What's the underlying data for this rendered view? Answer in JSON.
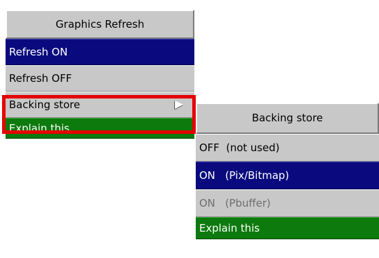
{
  "graphics_menu": {
    "title": "Graphics Refresh",
    "items": [
      {
        "label": "Refresh ON",
        "state": "selected"
      },
      {
        "label": "Refresh OFF",
        "state": "normal"
      },
      {
        "label": "Backing store",
        "state": "normal",
        "has_submenu": true,
        "submenu_icon": "triangle-right-icon"
      }
    ],
    "explain_label": "Explain this"
  },
  "backing_store_menu": {
    "title": "Backing store",
    "items": [
      {
        "label": "OFF  (not used)",
        "state": "normal"
      },
      {
        "label": "ON   (Pix/Bitmap)",
        "state": "selected"
      },
      {
        "label": "ON   (Pbuffer)",
        "state": "disabled"
      }
    ],
    "explain_label": "Explain this"
  },
  "colors": {
    "menu_bg": "#c8c8c8",
    "selected_bg": "#0a0a7e",
    "explain_bg": "#0d7a0d",
    "highlight_border": "#e60000",
    "disabled_text": "#6e6e6e"
  }
}
